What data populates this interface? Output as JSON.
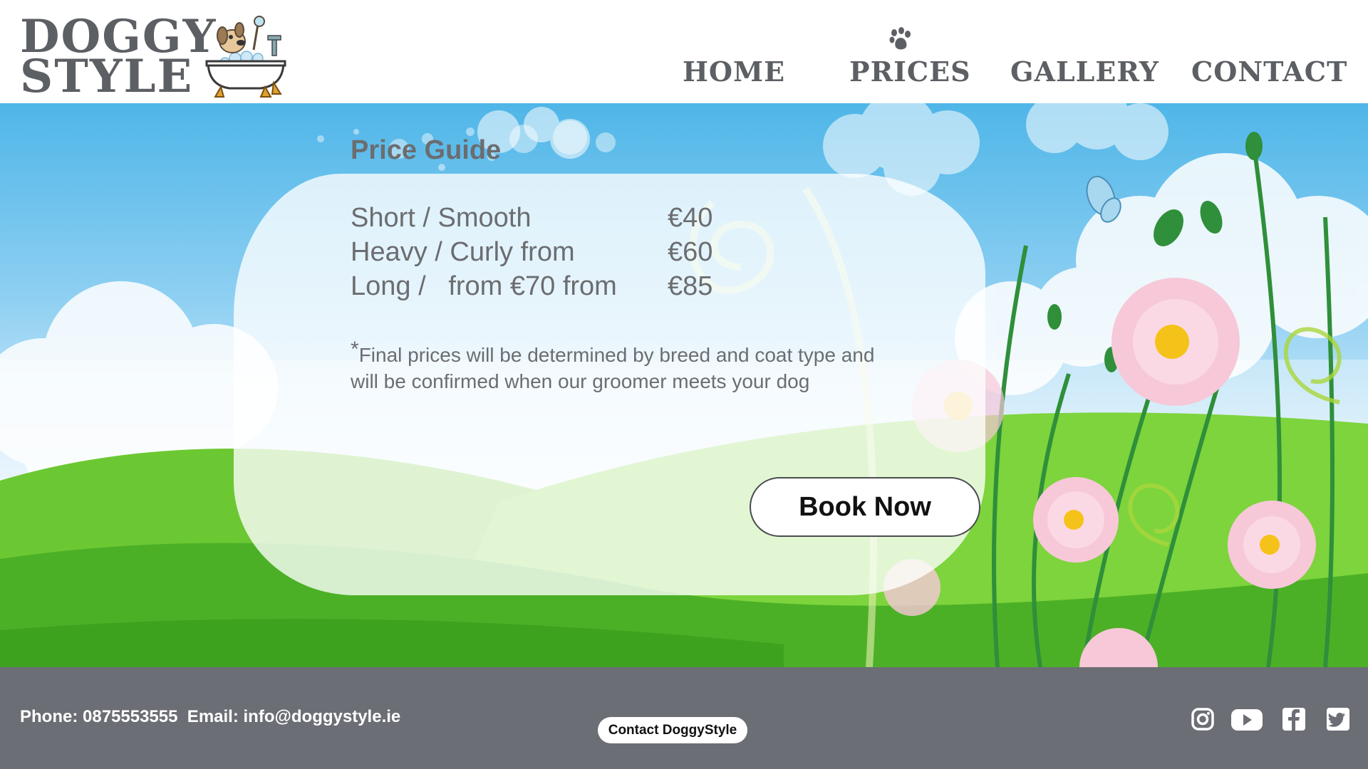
{
  "header": {
    "logo": {
      "line1": "DOGGY",
      "line2": "STYLE"
    },
    "nav": [
      {
        "label": "HOME"
      },
      {
        "label": "PRICES"
      },
      {
        "label": "GALLERY"
      },
      {
        "label": "CONTACT"
      }
    ],
    "active_icon": "paw-icon"
  },
  "main": {
    "title": "Price Guide",
    "prices": [
      {
        "label": "Short / Smooth",
        "amount": "€40"
      },
      {
        "label": "Heavy / Curly from",
        "amount": "€60"
      },
      {
        "label": "Long /   from €70 from",
        "amount": "€85"
      }
    ],
    "note_asterisk": "*",
    "note": "Final prices will be determined by breed and coat type and will be confirmed when our groomer meets your dog",
    "book_button": "Book Now"
  },
  "footer": {
    "contact_line": "Phone: 0875553555  Email: info@doggystyle.ie",
    "contact_button": "Contact DoggyStyle",
    "social_icons": [
      "instagram-icon",
      "youtube-icon",
      "facebook-icon",
      "twitter-icon"
    ]
  },
  "colors": {
    "text_grey": "#6b6d70",
    "footer_bg": "#6b6e74",
    "sky": "#4fb6e8",
    "grass": "#5cbf2a"
  }
}
